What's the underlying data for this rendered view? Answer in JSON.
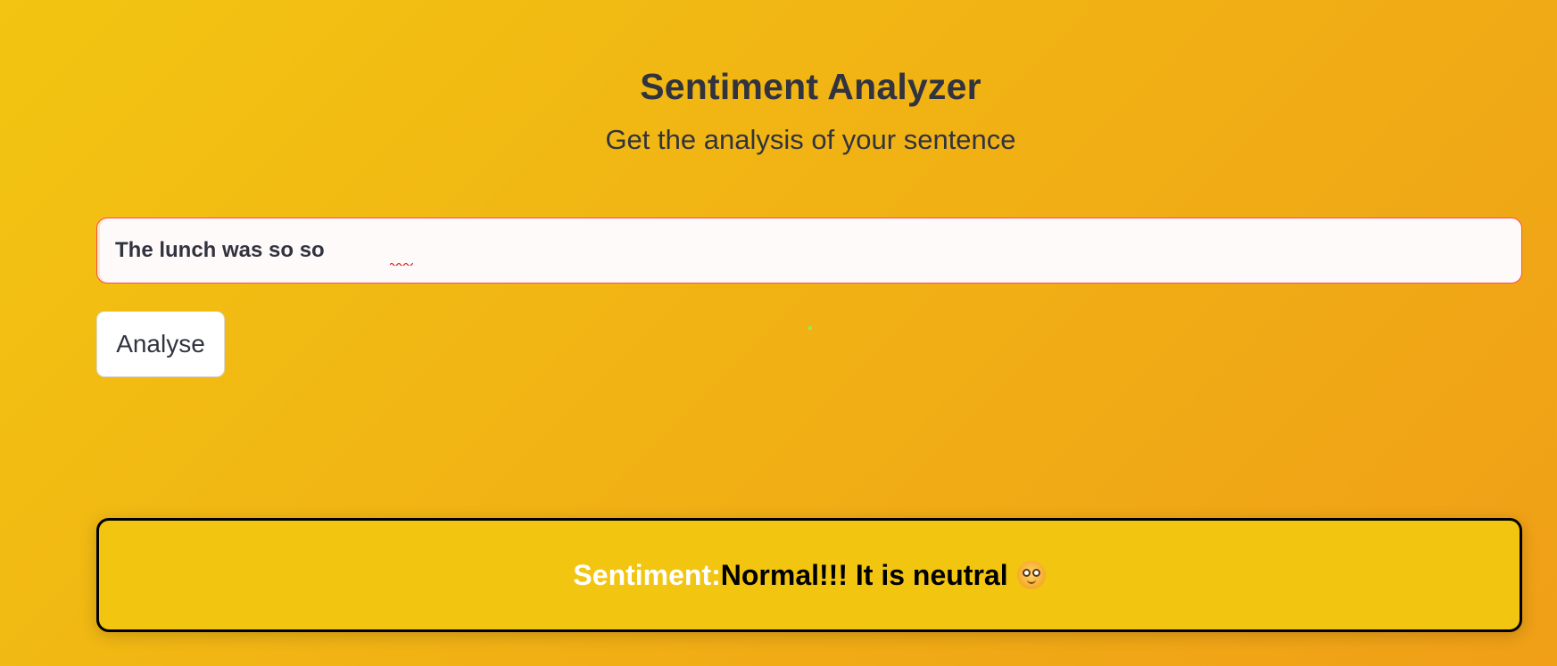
{
  "header": {
    "title": "Sentiment Analyzer",
    "subtitle": "Get the analysis of your sentence"
  },
  "input": {
    "value": "The lunch was so so"
  },
  "actions": {
    "analyse_label": "Analyse"
  },
  "result": {
    "label": "Sentiment:",
    "value": "Normal!!! It is neutral",
    "icon": "neutral-face-emoji-icon"
  },
  "colors": {
    "background_start": "#f2c511",
    "background_end": "#f09f17",
    "input_border": "#ff4b4b",
    "result_background": "#f2c511",
    "result_border": "#000000",
    "text": "#31333f"
  }
}
